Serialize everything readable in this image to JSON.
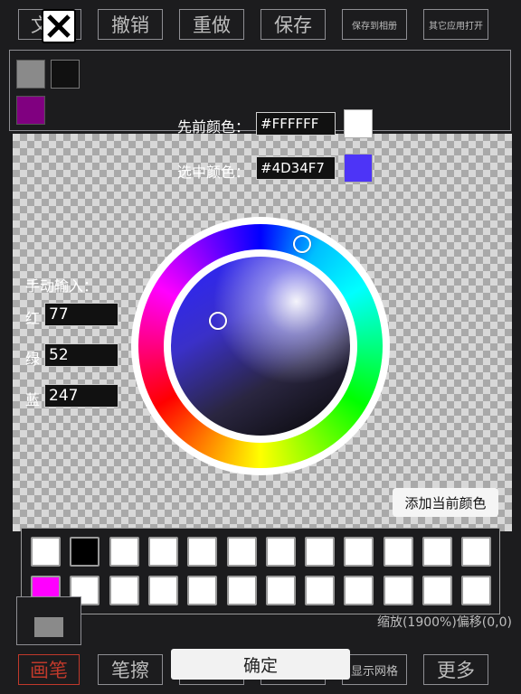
{
  "toolbar_top": {
    "text_label": "文字",
    "undo": "撤销",
    "redo": "重做",
    "save": "保存",
    "save_album": "保存到相册",
    "open_other": "其它应用打开"
  },
  "recent_colors": [
    "#8a8a8a",
    "#111111",
    "#800080"
  ],
  "picker": {
    "prev_label": "先前颜色：",
    "prev_hex": "#FFFFFF",
    "prev_color": "#FFFFFF",
    "sel_label": "选中颜色：",
    "sel_hex": "#4D34F7",
    "sel_color": "#4D34F7",
    "manual_label": "手动输入：",
    "red_label": "红",
    "red_value": "77",
    "green_label": "绿",
    "green_value": "52",
    "blue_label": "蓝",
    "blue_value": "247",
    "add_label": "添加当前颜色"
  },
  "palette": {
    "row1": [
      "#ffffff",
      "#000000",
      "#ffffff",
      "#ffffff",
      "#ffffff",
      "#ffffff",
      "#ffffff",
      "#ffffff",
      "#ffffff",
      "#ffffff",
      "#ffffff",
      "#ffffff"
    ],
    "row2": [
      "#ff00ff",
      "#ffffff",
      "#ffffff",
      "#ffffff",
      "#ffffff",
      "#ffffff",
      "#ffffff",
      "#ffffff",
      "#ffffff",
      "#ffffff",
      "#ffffff",
      "#ffffff"
    ]
  },
  "status": "缩放(1900%)偏移(0,0)",
  "toolbar_bottom": {
    "pen": "画笔",
    "eraser": "笔擦",
    "grid": "显示网格",
    "more": "更多"
  },
  "confirm": "确定"
}
